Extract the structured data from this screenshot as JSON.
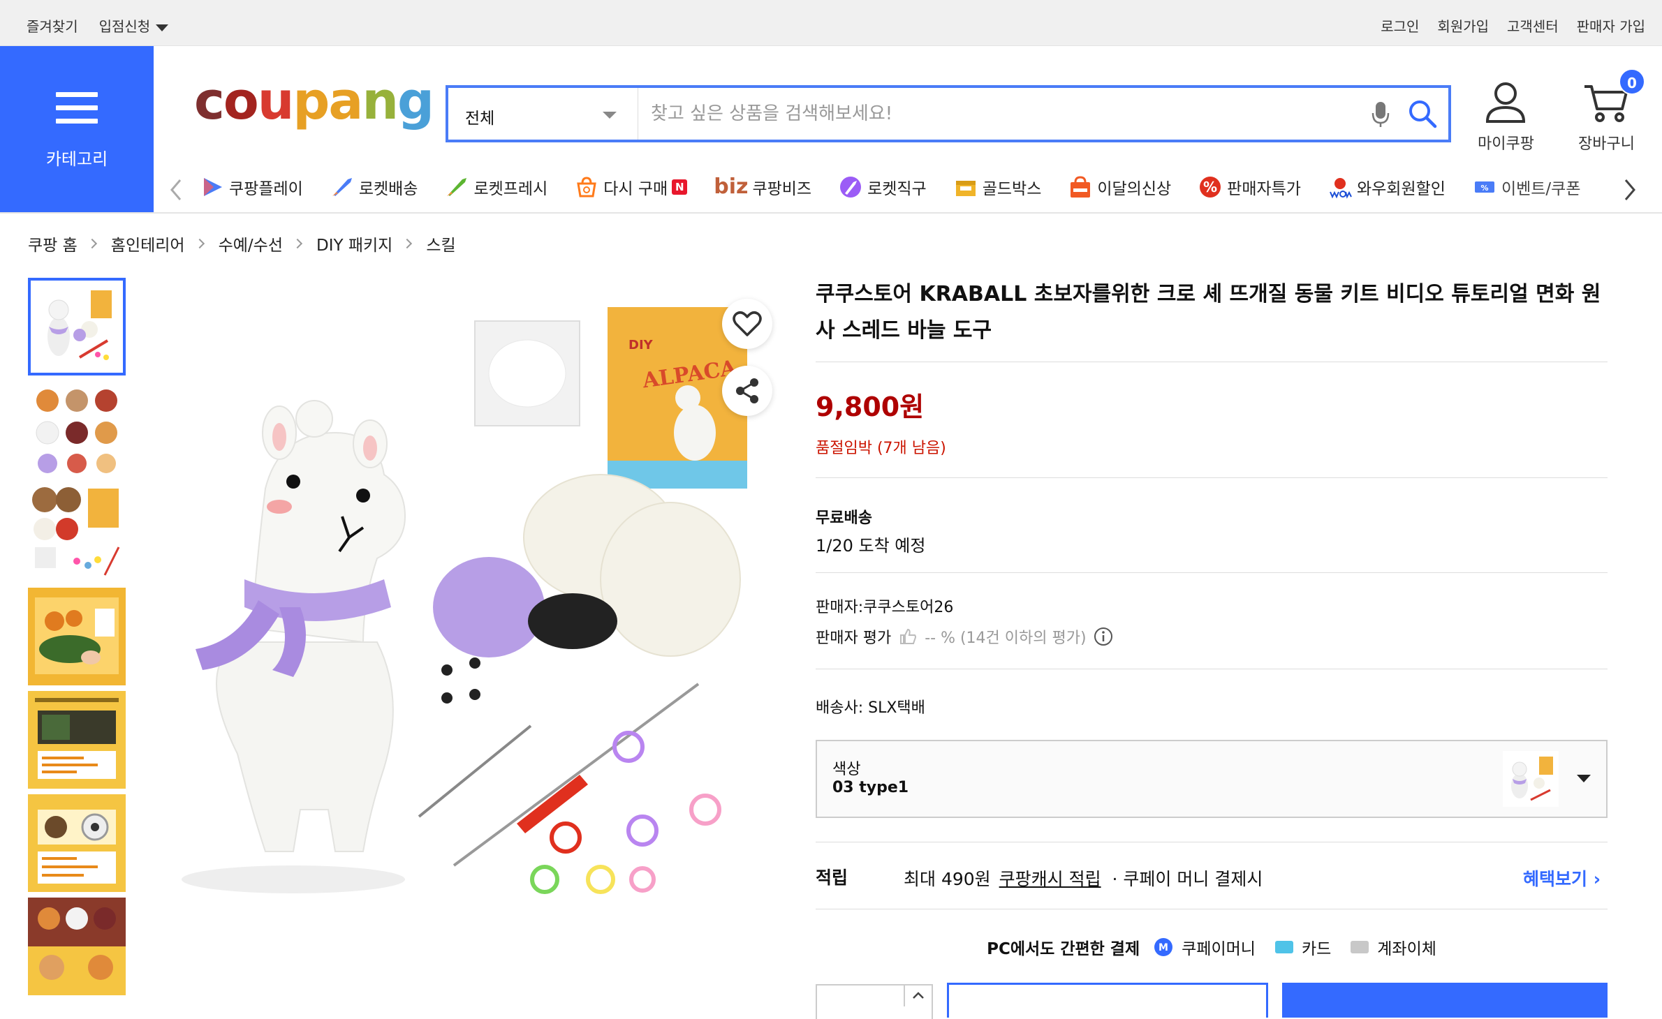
{
  "topbar": {
    "bookmark": "즐겨찾기",
    "seller_apply": "입점신청",
    "login": "로그인",
    "signup": "회원가입",
    "customer_center": "고객센터",
    "seller_signup": "판매자 가입"
  },
  "header": {
    "category_label": "카테고리",
    "logo_text": [
      "c",
      "o",
      "u",
      "p",
      "a",
      "n",
      "g"
    ],
    "logo_alt": "coupang",
    "search_category": "전체",
    "search_placeholder": "찾고 싶은 상품을 검색해보세요!",
    "mycoupang": "마이쿠팡",
    "cart": "장바구니",
    "cart_count": "0"
  },
  "nav": {
    "items": [
      {
        "label": "쿠팡플레이",
        "icon": "play-icon"
      },
      {
        "label": "로켓배송",
        "icon": "rocket-icon"
      },
      {
        "label": "로켓프레시",
        "icon": "rocket-fresh-icon"
      },
      {
        "label": "다시 구매",
        "icon": "rebuy-icon",
        "badge": "N"
      },
      {
        "label": "쿠팡비즈",
        "prefix": "biz",
        "icon": "biz-icon"
      },
      {
        "label": "로켓직구",
        "icon": "global-rocket-icon"
      },
      {
        "label": "골드박스",
        "icon": "goldbox-icon"
      },
      {
        "label": "이달의신상",
        "icon": "new-bag-icon"
      },
      {
        "label": "판매자특가",
        "icon": "percent-icon"
      },
      {
        "label": "와우회원할인",
        "icon": "wow-icon"
      },
      {
        "label": "이벤트/쿠폰",
        "icon": "coupon-icon"
      }
    ]
  },
  "breadcrumb": [
    "쿠팡 홈",
    "홈인테리어",
    "수예/수선",
    "DIY 패키지",
    "스킬"
  ],
  "product": {
    "title": "쿠쿠스토어 KRABALL 초보자를위한 크로 셰 뜨개질 동물 키트 비디오 튜토리얼 면화 원사 스레드 바늘 도구",
    "price": "9,800원",
    "stock_notice": "품절임박 (7개 남음)",
    "shipping_title": "무료배송",
    "arrival": "1/20 도착 예정",
    "seller": "판매자:쿠쿠스토어26",
    "seller_rating_label": "판매자 평가",
    "seller_rating_value": "-- % (14건 이하의 평가)",
    "courier": "배송사:  SLX택배",
    "option_label": "색상",
    "option_value": "03 type1",
    "reward_label": "적립",
    "reward_text_pre": "최대 490원",
    "reward_link": "쿠팡캐시 적립",
    "reward_text_post": "· 쿠페이 머니 결제시",
    "reward_more": "혜택보기",
    "pay_title": "PC에서도 간편한 결제",
    "pay_money": "쿠페이머니",
    "pay_card": "카드",
    "pay_transfer": "계좌이체",
    "box_text": "ALPACA",
    "box_small": "DIY"
  },
  "colors": {
    "brand_blue": "#346aff",
    "price_red": "#ae0000",
    "stock_red": "#cb1400"
  }
}
